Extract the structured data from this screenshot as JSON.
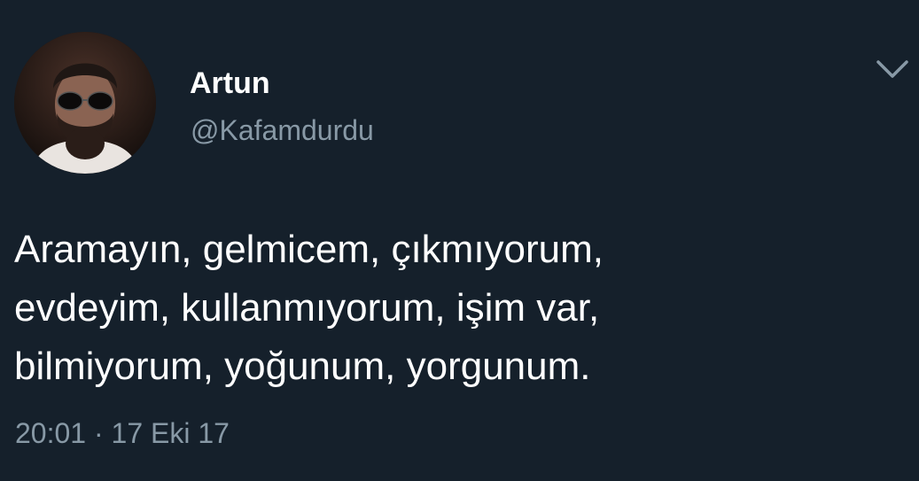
{
  "tweet": {
    "author": {
      "name": "Artun",
      "handle": "@Kafamdurdu"
    },
    "text_lines": [
      "Aramayın, gelmicem, çıkmıyorum,",
      "evdeyim, kullanmıyorum, işim var,",
      "bilmiyorum, yoğunum, yorgunum."
    ],
    "time": "20:01",
    "separator": "·",
    "date": "17 Eki 17"
  },
  "icons": {
    "menu": "chevron-down-icon"
  },
  "colors": {
    "background": "#15202b",
    "primary_text": "#ffffff",
    "secondary_text": "#8899a6"
  }
}
